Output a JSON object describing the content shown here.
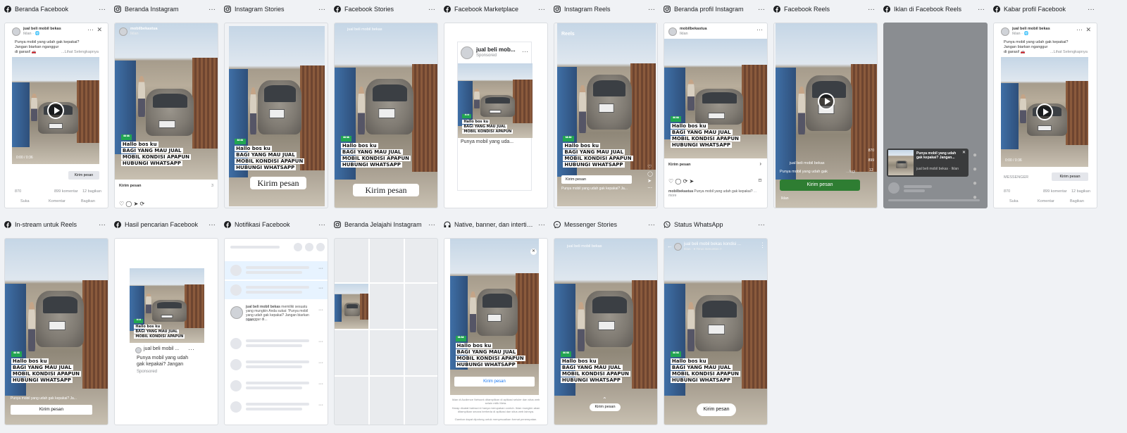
{
  "tile_labels": [
    "Beranda Facebook",
    "Beranda Instagram",
    "Instagram Stories",
    "Facebook Stories",
    "Facebook Marketplace",
    "Instagram Reels",
    "Beranda profil Instagram",
    "Facebook Reels",
    "Iklan di Facebook Reels",
    "Kabar profil Facebook",
    "In-stream untuk Reels",
    "Hasil pencarian Facebook",
    "Notifikasi Facebook",
    "Beranda Jelajahi Instagram",
    "Native, banner, dan intertis…",
    "Messenger Stories",
    "Status WhatsApp"
  ],
  "icons": {
    "facebook": "facebook-icon",
    "instagram": "instagram-icon",
    "audience_network": "audience-network-icon",
    "messenger": "messenger-icon",
    "whatsapp": "whatsapp-icon",
    "more": "more-options-icon"
  },
  "colors": {
    "facebook": "#1877f2",
    "whatsapp_cta": "#2e7d32",
    "quote_badge": "#22a652",
    "selected_row": "#e7f3ff"
  },
  "more_label": "···",
  "ad": {
    "page_name": "jual beli mobil bekas",
    "page_name_short": "jual beli mob...",
    "page_name_short2": "jual beli mobil ...",
    "page_name_long": "jual beli mobil bekas kondisi ...",
    "ig_handle": "mobilbekastua",
    "sponsored_id": "Iklan",
    "sponsored_en": "Sponsored",
    "sponsored_meta": "Iklan · 🌐",
    "body_line1": "Punya mobil yang udah gak kepakai?",
    "body_line2": "Jangan biarkan nganggur",
    "body_line3": "di garasi! 🚗",
    "see_more": "...Lihat Selengkapnya",
    "short_body": "Punya mobil yang uda...",
    "search_body_1": "Punya mobil yang udah",
    "search_body_2": "gak kepakai? Jangan",
    "reels_caption": "Punya mobil yang udah gak",
    "reels_caption_more": "...lagi",
    "instream_caption": "Punya mobil yang udah gak kepakai? Ja...",
    "ig_caption_handle": "mobilbekastua",
    "ig_caption_rest": "Punya mobil yang udah gak kepakai?",
    "ig_caption_more": "... more",
    "notif_text": "memiliki sesuatu yang mungkin Anda sukai: 'Punya mobil yang udah gak kepakai? Jangan biarkan nganggur di...",
    "cta": "Kirim pesan",
    "overlay_quote": "❝❝",
    "overlay_l1": "Hallo bos ku",
    "overlay_l2": "BAGI YANG MAU JUAL",
    "overlay_l3": "MOBIL KONDISI APAPUN",
    "overlay_l4": "HUBUNGI WHATSAPP",
    "video_time": "0:00 / 0:36",
    "reactions": "870",
    "comments": "899 komentar",
    "shares": "12 bagikan",
    "like": "Suka",
    "comment": "Komentar",
    "share": "Bagikan",
    "reels_label": "Reels",
    "messenger_label": "MESSENGER",
    "count_870": "870",
    "count_899": "899",
    "count_12": "12",
    "count_3": "3",
    "wa_meta": "Iklan · ● Terus menonton >",
    "popup_title": "Punya mobil yang udah gak kepakai? Jangan...",
    "popup_sub": "jual beli mobil bekas · Iklan",
    "an_line1": "Iklan di Audience Network ditampilkan di aplikasi seluler dan situs web selain milik Meta.",
    "an_line2": "Harap dicatat bahwa ini hanya merupakan contoh. Iklan mungkin akan ditampilkan secara berbeda di aplikasi dan situs web lainnya.",
    "an_line3": "Gambar dapat dipotong untuk menyesuaikan format penempatan."
  }
}
